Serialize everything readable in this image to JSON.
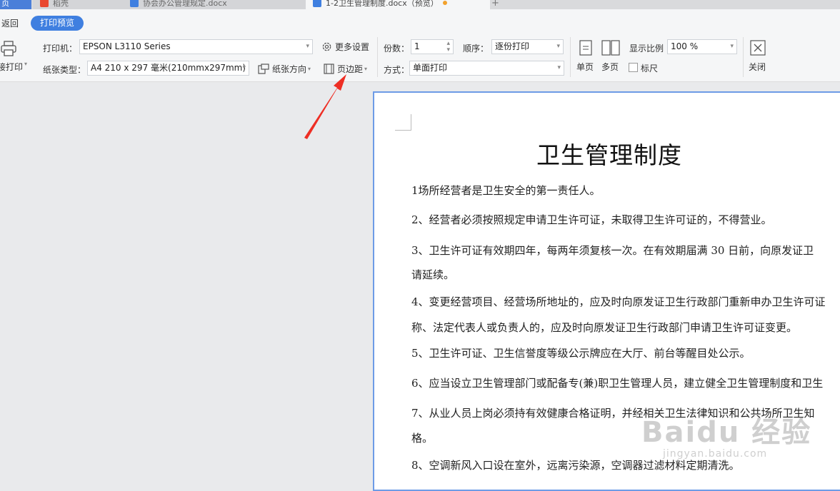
{
  "tabs": {
    "home": "页",
    "daoke": "稻壳",
    "doc2": "协会办公管理规定.docx",
    "active": "1-2卫生管理制度.docx（预览）",
    "add": "+"
  },
  "subbar": {
    "back": "返回",
    "preview": "打印预览"
  },
  "ribbon": {
    "print_direct": "直接打印",
    "printer_label": "打印机：",
    "printer_value": "EPSON L3110 Series",
    "more_settings": "更多设置",
    "paper_type_label": "纸张类型：",
    "paper_type_value": "A4 210 x 297 毫米(210mmx297mm)",
    "paper_direction": "纸张方向",
    "margins": "页边距",
    "copies_label": "份数：",
    "copies_value": "1",
    "order_label": "顺序：",
    "order_value": "逐份打印",
    "mode_label": "方式：",
    "mode_value": "单面打印",
    "single_page": "单页",
    "multi_page": "多页",
    "zoom_label": "显示比例",
    "zoom_value": "100 %",
    "ruler": "标尺",
    "close": "关闭"
  },
  "document": {
    "title": "卫生管理制度",
    "paragraphs": [
      "1场所经营者是卫生安全的第一责任人。",
      "2、经营者必须按照规定申请卫生许可证，未取得卫生许可证的，不得营业。",
      "3、卫生许可证有效期四年，每两年须复核一次。在有效期届满 30 日前，向原发证卫",
      "请延续。",
      "4、变更经营项目、经营场所地址的，应及时向原发证卫生行政部门重新申办卫生许可证",
      "称、法定代表人或负责人的，应及时向原发证卫生行政部门申请卫生许可证变更。",
      "5、卫生许可证、卫生信誉度等级公示牌应在大厅、前台等醒目处公示。",
      "6、应当设立卫生管理部门或配备专(兼)职卫生管理人员，建立健全卫生管理制度和卫生",
      "7、从业人员上岗必须持有效健康合格证明，并经相关卫生法律知识和公共场所卫生知",
      "格。",
      "8、空调新风入口设在室外，远离污染源，空调器过滤材料定期清洗。"
    ]
  },
  "watermark": {
    "main": "Baidu 经验",
    "sub": "jingyan.baidu.com"
  }
}
